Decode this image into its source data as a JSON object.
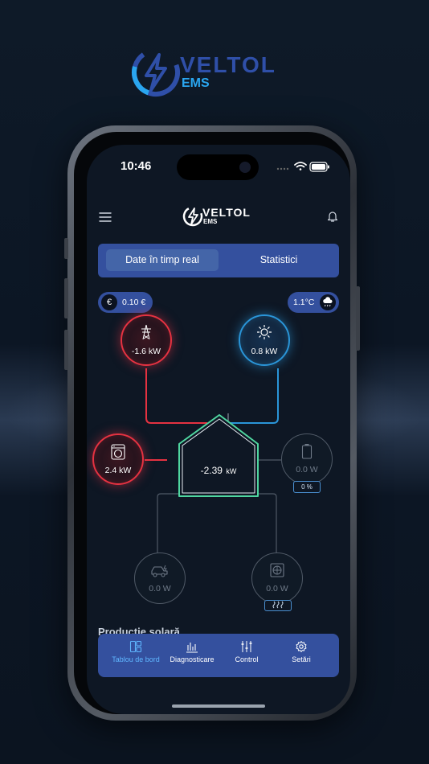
{
  "brand": {
    "name_top": "VELTOL",
    "name_bottom": "EMS"
  },
  "status_bar": {
    "time": "10:46"
  },
  "header": {
    "logo_top": "VELTOL",
    "logo_bottom": "EMS"
  },
  "tabs": [
    {
      "label": "Date în timp real",
      "active": true
    },
    {
      "label": "Statistici",
      "active": false
    }
  ],
  "price": {
    "symbol": "€",
    "value": "0.10 €"
  },
  "weather": {
    "temperature": "1.1°C",
    "icon": "cloud-rain-icon"
  },
  "energy_flow": {
    "grid": {
      "value": "-1.6 kW",
      "icon": "power-tower-icon",
      "state": "active-red"
    },
    "solar": {
      "value": "0.8 kW",
      "icon": "sun-icon",
      "state": "active-blue"
    },
    "consumption": {
      "value": "2.4 kW",
      "icon": "washing-machine-icon",
      "state": "active-red"
    },
    "house": {
      "value": "-2.39",
      "unit": "kW"
    },
    "battery": {
      "value": "0.0 W",
      "icon": "battery-icon",
      "percent": "0 %",
      "state": "inactive"
    },
    "ev_charger": {
      "value": "0.0 W",
      "icon": "ev-car-icon",
      "state": "inactive"
    },
    "heat_pump": {
      "value": "0.0 W",
      "icon": "heat-pump-icon",
      "badge_icon": "heat-waves-icon",
      "state": "inactive"
    }
  },
  "section": {
    "title": "Productie solară"
  },
  "bottom_nav": [
    {
      "label": "Tablou de bord",
      "icon": "dashboard-icon",
      "active": true
    },
    {
      "label": "Diagnosticare",
      "icon": "bar-chart-icon",
      "active": false
    },
    {
      "label": "Control",
      "icon": "sliders-icon",
      "active": false
    },
    {
      "label": "Setări",
      "icon": "gear-icon",
      "active": false
    }
  ],
  "colors": {
    "accent": "#34509e",
    "red": "#e53241",
    "blue": "#2a95d8",
    "green": "#4fd6a0",
    "active_nav": "#5fb6ff"
  }
}
